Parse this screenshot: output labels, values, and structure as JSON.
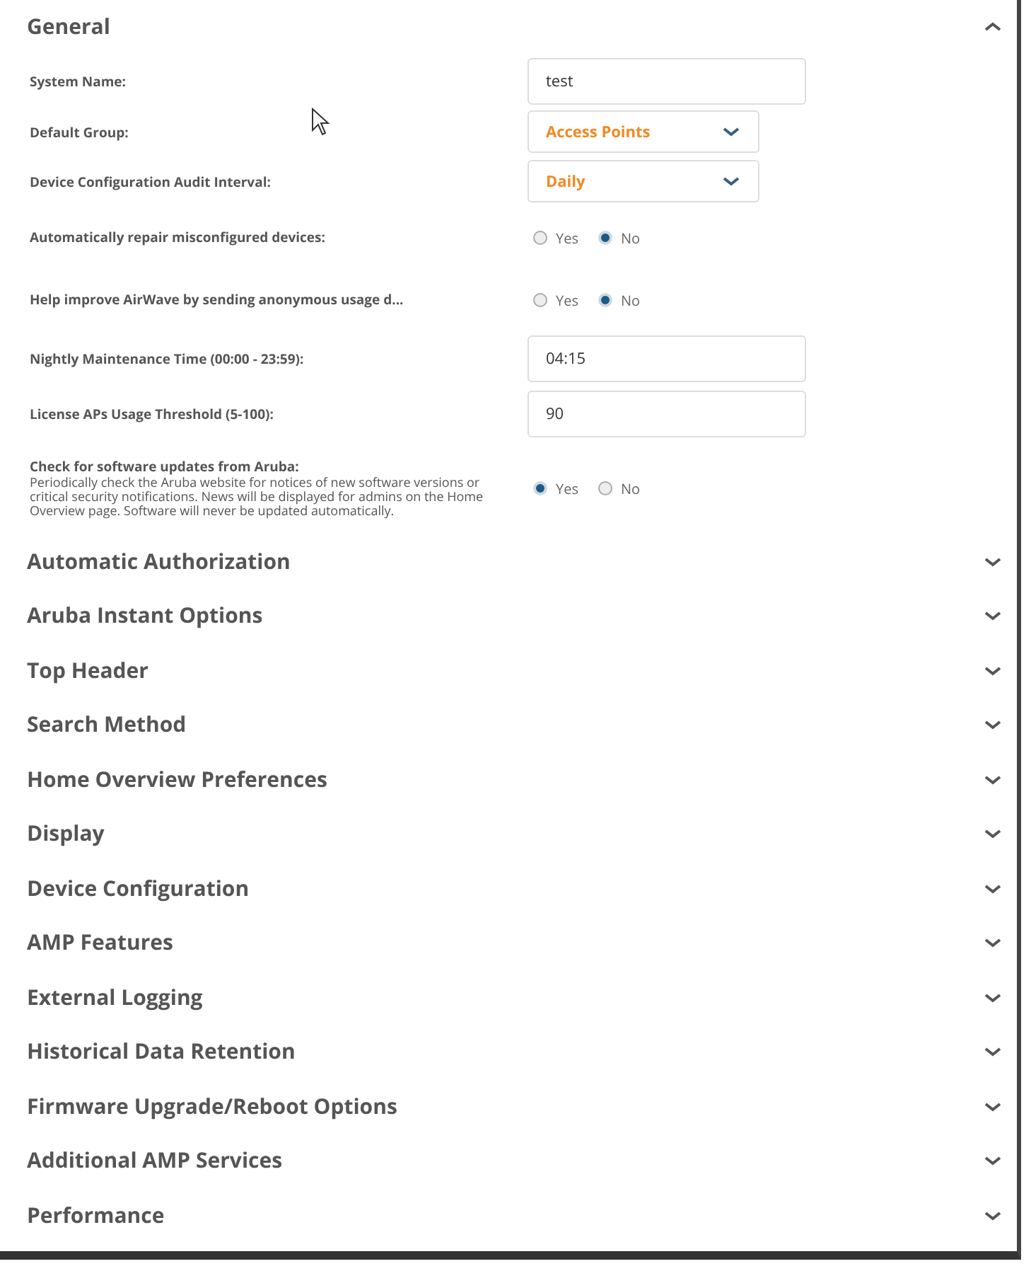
{
  "sections": [
    {
      "title": "General",
      "expanded": true,
      "fields": [
        {
          "kind": "text",
          "label": "System Name:",
          "value": "test"
        },
        {
          "kind": "select",
          "label": "Default Group:",
          "value": "Access Points"
        },
        {
          "kind": "select",
          "label": "Device Configuration Audit Interval:",
          "value": "Daily"
        },
        {
          "kind": "radio",
          "label": "Automatically repair misconfigured devices:",
          "options": [
            {
              "label": "Yes",
              "selected": false
            },
            {
              "label": "No",
              "selected": true
            }
          ]
        },
        {
          "kind": "radio",
          "label": "Help improve AirWave by sending anonymous usage d...",
          "options": [
            {
              "label": "Yes",
              "selected": false
            },
            {
              "label": "No",
              "selected": true
            }
          ]
        },
        {
          "kind": "text",
          "label": "Nightly Maintenance Time (00:00 - 23:59):",
          "value": "04:15"
        },
        {
          "kind": "text",
          "label": "License APs Usage Threshold (5-100):",
          "value": "90"
        },
        {
          "kind": "radio",
          "label": "Check for software updates from Aruba:",
          "description": "Periodically check the Aruba website for notices of new software versions or critical security notifications. News will be displayed for admins on the Home Overview page. Software will never be updated automatically.",
          "options": [
            {
              "label": "Yes",
              "selected": true
            },
            {
              "label": "No",
              "selected": false
            }
          ]
        }
      ]
    },
    {
      "title": "Automatic Authorization",
      "expanded": false
    },
    {
      "title": "Aruba Instant Options",
      "expanded": false
    },
    {
      "title": "Top Header",
      "expanded": false
    },
    {
      "title": "Search Method",
      "expanded": false
    },
    {
      "title": "Home Overview Preferences",
      "expanded": false
    },
    {
      "title": "Display",
      "expanded": false
    },
    {
      "title": "Device Configuration",
      "expanded": false
    },
    {
      "title": "AMP Features",
      "expanded": false
    },
    {
      "title": "External Logging",
      "expanded": false
    },
    {
      "title": "Historical Data Retention",
      "expanded": false
    },
    {
      "title": "Firmware Upgrade/Reboot Options",
      "expanded": false
    },
    {
      "title": "Additional AMP Services",
      "expanded": false
    },
    {
      "title": "Performance",
      "expanded": false
    }
  ]
}
